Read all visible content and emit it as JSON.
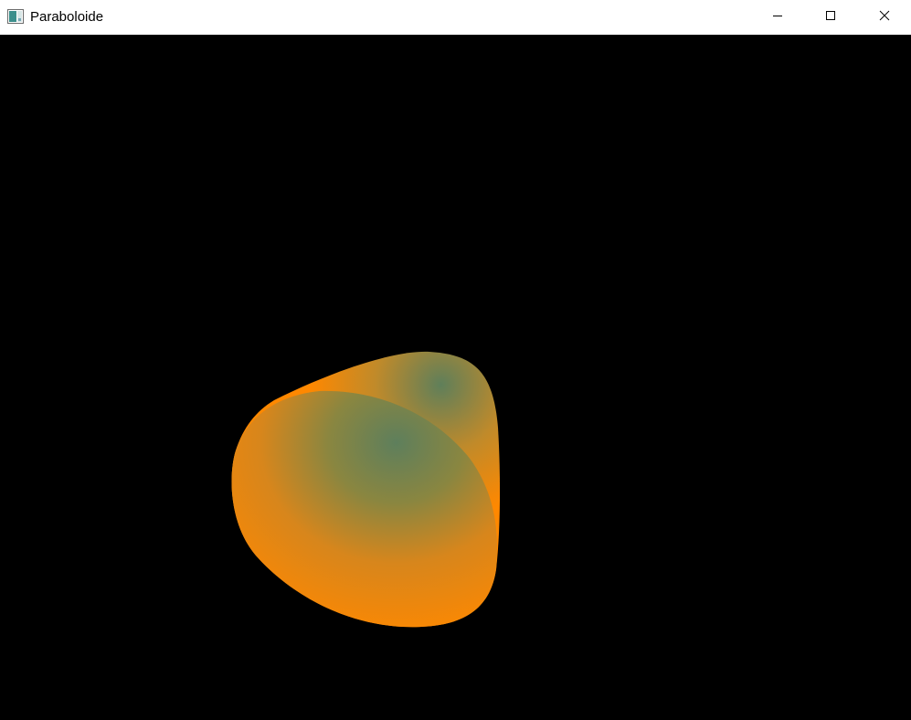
{
  "window": {
    "title": "Paraboloide",
    "icon": "app-window-icon",
    "controls": {
      "minimize_icon": "minimize-icon",
      "maximize_icon": "maximize-icon",
      "close_icon": "close-icon"
    }
  },
  "scene": {
    "background_color": "#000000",
    "surface_color_primary": "#ff8800",
    "surface_color_secondary": "#5f7f5a"
  }
}
